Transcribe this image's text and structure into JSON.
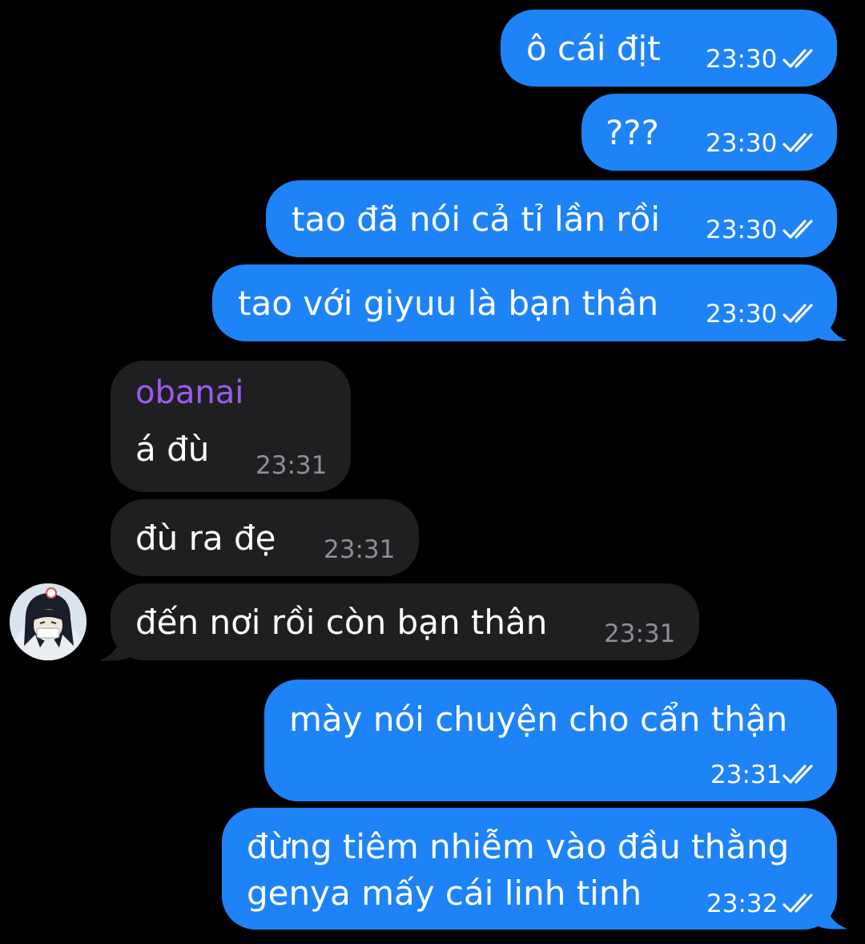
{
  "chat": {
    "contact_name": "obanai",
    "messages": [
      {
        "text": "ô cái địt",
        "time": "23:30"
      },
      {
        "text": "???",
        "time": "23:30"
      },
      {
        "text": "tao đã nói cả tỉ lần rồi",
        "time": "23:30"
      },
      {
        "text": "tao với giyuu là bạn thân",
        "time": "23:30"
      },
      {
        "sender": "obanai",
        "text": "á đù",
        "time": "23:31"
      },
      {
        "text": "đù ra đẹ",
        "time": "23:31"
      },
      {
        "text": "đến nơi rồi còn bạn thân",
        "time": "23:31"
      },
      {
        "text": "mày nói chuyện cho cẩn thận",
        "time": "23:31"
      },
      {
        "line1": "đừng tiêm nhiễm vào đầu thằng",
        "line2": "genya mấy cái linh tinh",
        "time": "23:32"
      }
    ]
  },
  "colors": {
    "background": "#000000",
    "outgoing_bubble": "#1e83f7",
    "incoming_bubble": "#1f1f21",
    "sender_name": "#9d5bf0",
    "incoming_time": "#8e8e93"
  },
  "icons": {
    "read_receipt": "double-check-icon",
    "avatar": "contact-avatar"
  }
}
